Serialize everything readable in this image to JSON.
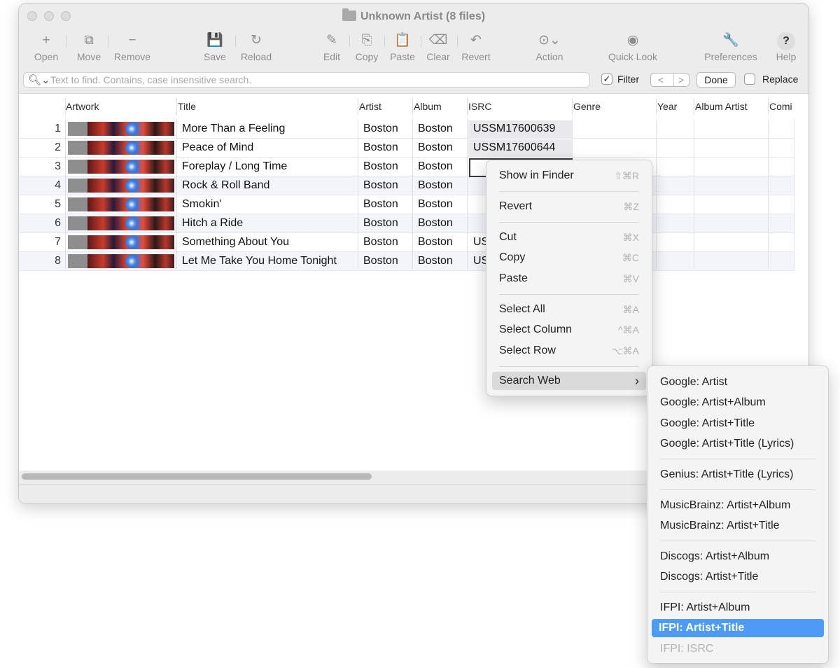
{
  "window": {
    "title": "Unknown Artist (8 files)"
  },
  "toolbar": {
    "items": [
      {
        "label": "Open",
        "icon": "+"
      },
      {
        "label": "Move",
        "icon": "⧉"
      },
      {
        "label": "Remove",
        "icon": "−"
      },
      {
        "label": "Save",
        "icon": "💾"
      },
      {
        "label": "Reload",
        "icon": "↻"
      },
      {
        "label": "Edit",
        "icon": "✎"
      },
      {
        "label": "Copy",
        "icon": "⎘"
      },
      {
        "label": "Paste",
        "icon": "📋"
      },
      {
        "label": "Clear",
        "icon": "⌫"
      },
      {
        "label": "Revert",
        "icon": "↶"
      },
      {
        "label": "Action",
        "icon": "⊙⌄"
      },
      {
        "label": "Quick Look",
        "icon": "◉"
      },
      {
        "label": "Preferences",
        "icon": "🔧"
      },
      {
        "label": "Help",
        "icon": "?"
      }
    ]
  },
  "search": {
    "placeholder": "Text to find. Contains, case insensitive search.",
    "value": "",
    "filter_label": "Filter",
    "filter_checked": true,
    "prev": "<",
    "next": ">",
    "done_label": "Done",
    "replace_label": "Replace"
  },
  "table": {
    "columns": [
      "Artwork",
      "Title",
      "Artist",
      "Album",
      "ISRC",
      "Genre",
      "Year",
      "Album Artist",
      "Comi"
    ],
    "rows": [
      {
        "num": "1",
        "title": "More Than a Feeling",
        "artist": "Boston",
        "album": "Boston",
        "isrc": "USSM17600639"
      },
      {
        "num": "2",
        "title": "Peace of Mind",
        "artist": "Boston",
        "album": "Boston",
        "isrc": "USSM17600644"
      },
      {
        "num": "3",
        "title": "Foreplay / Long Time",
        "artist": "Boston",
        "album": "Boston",
        "isrc": ""
      },
      {
        "num": "4",
        "title": "Rock & Roll Band",
        "artist": "Boston",
        "album": "Boston",
        "isrc": ""
      },
      {
        "num": "5",
        "title": "Smokin'",
        "artist": "Boston",
        "album": "Boston",
        "isrc": ""
      },
      {
        "num": "6",
        "title": "Hitch a Ride",
        "artist": "Boston",
        "album": "Boston",
        "isrc": ""
      },
      {
        "num": "7",
        "title": "Something About You",
        "artist": "Boston",
        "album": "Boston",
        "isrc": "US"
      },
      {
        "num": "8",
        "title": "Let Me Take You Home Tonight",
        "artist": "Boston",
        "album": "Boston",
        "isrc": "US"
      }
    ]
  },
  "context_menu": {
    "items": [
      {
        "label": "Show in Finder",
        "shortcut": "⇧⌘R"
      },
      {
        "label": "Revert",
        "shortcut": "⌘Z"
      },
      {
        "label": "Cut",
        "shortcut": "⌘X"
      },
      {
        "label": "Copy",
        "shortcut": "⌘C"
      },
      {
        "label": "Paste",
        "shortcut": "⌘V"
      },
      {
        "label": "Select All",
        "shortcut": "⌘A"
      },
      {
        "label": "Select Column",
        "shortcut": "^⌘A"
      },
      {
        "label": "Select Row",
        "shortcut": "⌥⌘A"
      },
      {
        "label": "Search Web",
        "shortcut": "›"
      }
    ]
  },
  "submenu": {
    "items": [
      {
        "label": "Google: Artist"
      },
      {
        "label": "Google: Artist+Album"
      },
      {
        "label": "Google: Artist+Title"
      },
      {
        "label": "Google: Artist+Title (Lyrics)"
      },
      {
        "label": "Genius: Artist+Title (Lyrics)"
      },
      {
        "label": "MusicBrainz: Artist+Album"
      },
      {
        "label": "MusicBrainz: Artist+Title"
      },
      {
        "label": "Discogs: Artist+Album"
      },
      {
        "label": "Discogs: Artist+Title"
      },
      {
        "label": "IFPI: Artist+Album"
      },
      {
        "label": "IFPI: Artist+Title",
        "highlighted": true
      },
      {
        "label": "IFPI: ISRC",
        "disabled": true
      }
    ]
  },
  "colors": {
    "accent": "#4c9bf5",
    "row_alt": "#f2f6fb"
  }
}
